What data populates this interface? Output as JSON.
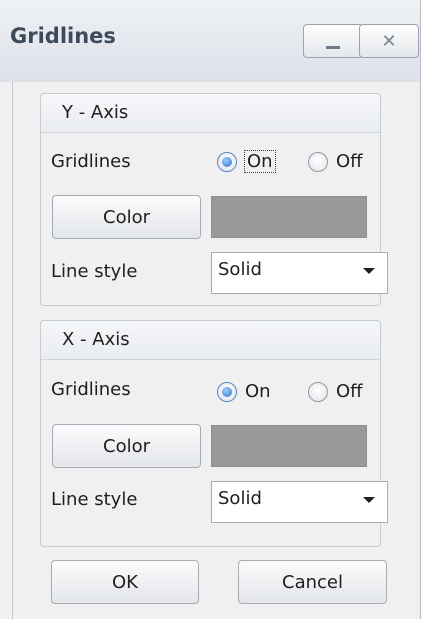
{
  "window": {
    "title": "Gridlines",
    "minimize_icon": "minimize-icon",
    "close_label": "✕",
    "close_icon": "close-icon"
  },
  "y_axis": {
    "title": "Y - Axis",
    "gridlines_label": "Gridlines",
    "on_label": "On",
    "off_label": "Off",
    "gridlines_selected": "On",
    "color_button": "Color",
    "color_value": "#999999",
    "line_style_label": "Line style",
    "line_style_value": "Solid"
  },
  "x_axis": {
    "title": "X - Axis",
    "gridlines_label": "Gridlines",
    "on_label": "On",
    "off_label": "Off",
    "gridlines_selected": "On",
    "color_button": "Color",
    "color_value": "#999999",
    "line_style_label": "Line style",
    "line_style_value": "Solid"
  },
  "footer": {
    "ok_label": "OK",
    "cancel_label": "Cancel"
  }
}
